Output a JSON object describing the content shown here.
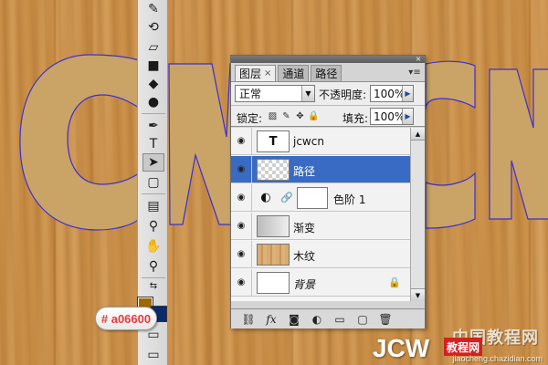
{
  "canvas": {
    "text": "CWCN",
    "letter_color": "#c9a466",
    "path_color": "#3b2fd6",
    "background": "wood"
  },
  "toolbox": {
    "tools": [
      {
        "name": "spot-healing-icon"
      },
      {
        "name": "history-brush-icon"
      },
      {
        "name": "eraser-icon"
      },
      {
        "name": "gradient-icon"
      },
      {
        "name": "blur-icon"
      },
      {
        "name": "dodge-icon"
      },
      {
        "name": "pen-icon"
      },
      {
        "name": "type-tool-icon"
      },
      {
        "name": "path-selection-icon"
      },
      {
        "name": "shape-icon"
      },
      {
        "name": "notes-icon"
      },
      {
        "name": "eyedropper-icon"
      },
      {
        "name": "hand-icon"
      },
      {
        "name": "zoom-icon"
      }
    ],
    "foreground_color": "#a06600",
    "background_color": "#0a2b6b"
  },
  "color_tag": "# a06600",
  "layers_panel": {
    "tabs": [
      {
        "label": "图层",
        "close": "×"
      },
      {
        "label": "通道"
      },
      {
        "label": "路径"
      }
    ],
    "blend_mode": "正常",
    "opacity_label": "不透明度:",
    "opacity_value": "100%",
    "lock_label": "锁定:",
    "fill_label": "填充:",
    "fill_value": "100%",
    "layers": [
      {
        "name": "jcwcn",
        "thumb": "T",
        "selected": false
      },
      {
        "name": "路径",
        "thumb": "",
        "selected": true
      },
      {
        "name": "色阶 1",
        "thumb": "",
        "selected": false
      },
      {
        "name": "渐变",
        "thumb": "",
        "selected": false
      },
      {
        "name": "木纹",
        "thumb": "",
        "selected": false
      },
      {
        "name": "背景",
        "thumb": "",
        "selected": false
      }
    ]
  },
  "watermark": {
    "cn": "中国教程网",
    "jcw": "JCW",
    "badge": "教程网",
    "url": "jiaocheng.chazidian.com"
  }
}
